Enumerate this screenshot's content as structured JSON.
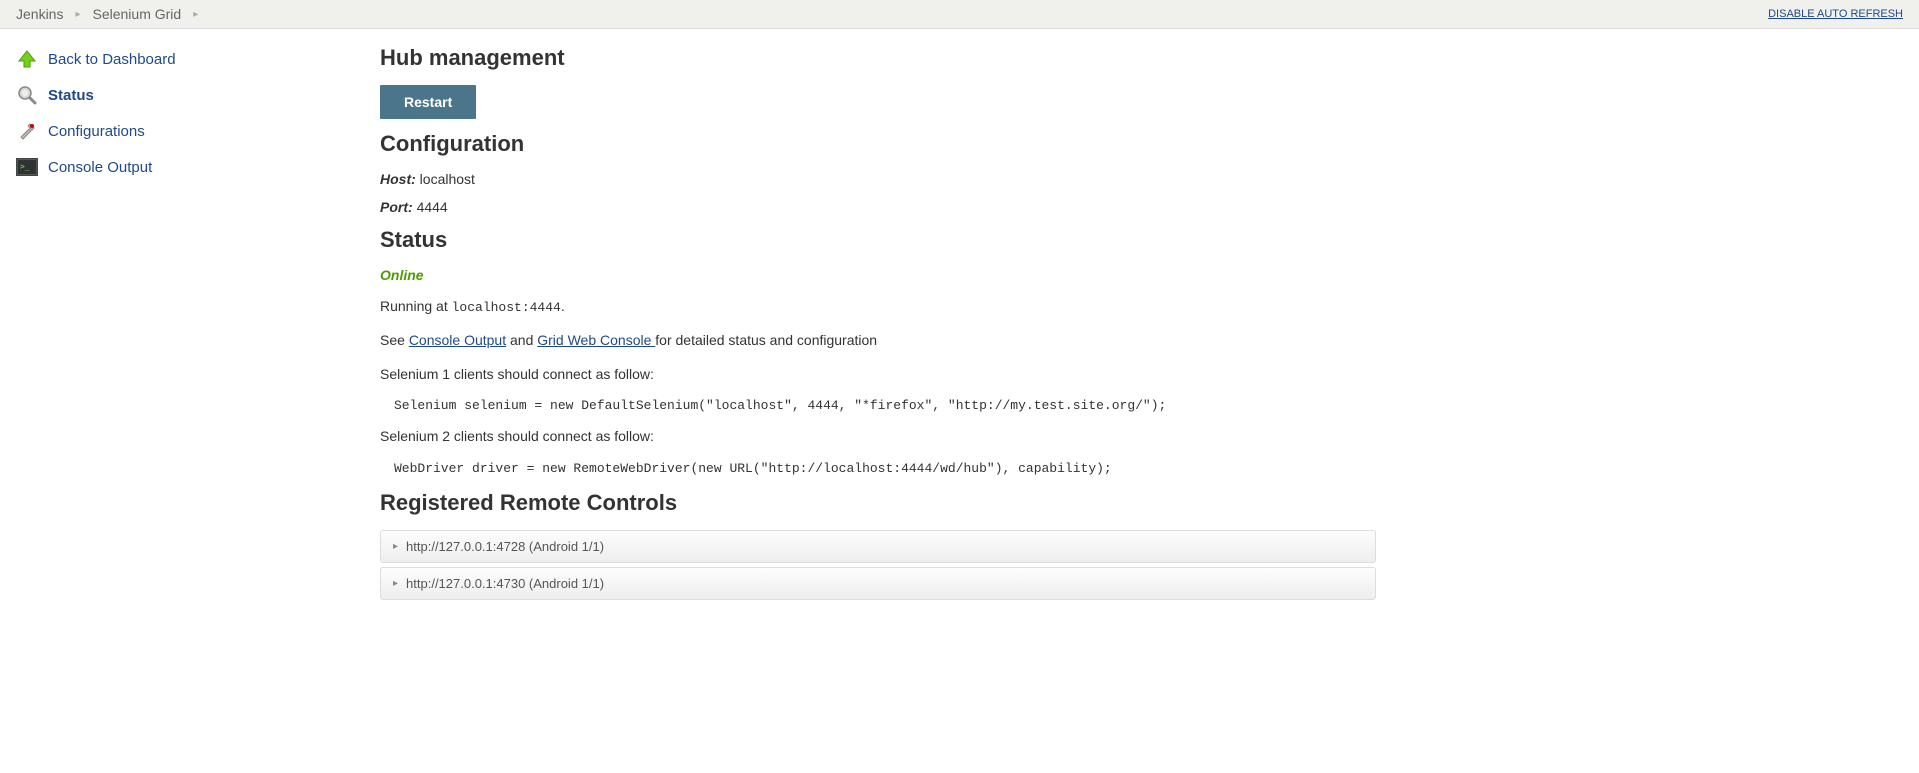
{
  "breadcrumbs": {
    "items": [
      "Jenkins",
      "Selenium Grid"
    ],
    "disable_refresh": "DISABLE AUTO REFRESH"
  },
  "sidebar": {
    "items": [
      {
        "label": "Back to Dashboard",
        "icon": "up-arrow-icon"
      },
      {
        "label": "Status",
        "icon": "search-icon",
        "active": true
      },
      {
        "label": "Configurations",
        "icon": "tools-icon"
      },
      {
        "label": "Console Output",
        "icon": "console-icon"
      }
    ]
  },
  "main": {
    "hub_title": "Hub management",
    "restart_label": "Restart",
    "config_title": "Configuration",
    "host_label": "Host:",
    "host_value": "localhost",
    "port_label": "Port:",
    "port_value": "4444",
    "status_title": "Status",
    "status_value": "Online",
    "running_prefix": "Running at ",
    "running_address": "localhost:4444",
    "running_suffix": ".",
    "see_prefix": "See ",
    "console_output_link": "Console Output",
    "see_and": " and ",
    "grid_web_console_link": "Grid Web Console ",
    "see_suffix": "for detailed status and configuration",
    "sel1_text": "Selenium 1 clients should connect as follow:",
    "sel1_code": "Selenium selenium = new DefaultSelenium(\"localhost\", 4444, \"*firefox\", \"http://my.test.site.org/\");",
    "sel2_text": "Selenium 2 clients should connect as follow:",
    "sel2_code": "WebDriver driver = new RemoteWebDriver(new URL(\"http://localhost:4444/wd/hub\"), capability);",
    "rc_title": "Registered Remote Controls",
    "rc_items": [
      "http://127.0.0.1:4728 (Android 1/1)",
      "http://127.0.0.1:4730 (Android 1/1)"
    ]
  }
}
